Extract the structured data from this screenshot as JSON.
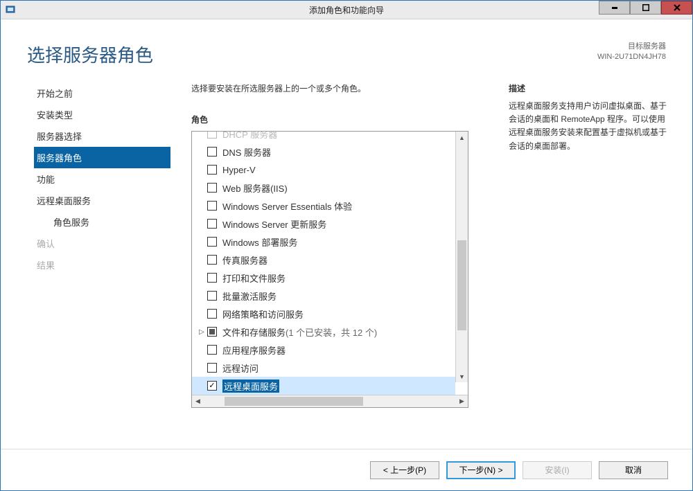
{
  "window": {
    "title": "添加角色和功能向导"
  },
  "page_title": "选择服务器角色",
  "target": {
    "label": "目标服务器",
    "name": "WIN-2U71DN4JH78"
  },
  "sidebar": {
    "items": [
      {
        "label": "开始之前",
        "active": false,
        "sub": false,
        "disabled": false
      },
      {
        "label": "安装类型",
        "active": false,
        "sub": false,
        "disabled": false
      },
      {
        "label": "服务器选择",
        "active": false,
        "sub": false,
        "disabled": false
      },
      {
        "label": "服务器角色",
        "active": true,
        "sub": false,
        "disabled": false
      },
      {
        "label": "功能",
        "active": false,
        "sub": false,
        "disabled": false
      },
      {
        "label": "远程桌面服务",
        "active": false,
        "sub": false,
        "disabled": false
      },
      {
        "label": "角色服务",
        "active": false,
        "sub": true,
        "disabled": false
      },
      {
        "label": "确认",
        "active": false,
        "sub": false,
        "disabled": true
      },
      {
        "label": "结果",
        "active": false,
        "sub": false,
        "disabled": true
      }
    ]
  },
  "main": {
    "instruction": "选择要安装在所选服务器上的一个或多个角色。",
    "roles_label": "角色",
    "roles": [
      {
        "label": "DHCP 服务器",
        "checked": false,
        "indeterminate": false,
        "expandable": false,
        "selected": false,
        "cut": true
      },
      {
        "label": "DNS 服务器",
        "checked": false,
        "indeterminate": false,
        "expandable": false,
        "selected": false
      },
      {
        "label": "Hyper-V",
        "checked": false,
        "indeterminate": false,
        "expandable": false,
        "selected": false
      },
      {
        "label": "Web 服务器(IIS)",
        "checked": false,
        "indeterminate": false,
        "expandable": false,
        "selected": false
      },
      {
        "label": "Windows Server Essentials 体验",
        "checked": false,
        "indeterminate": false,
        "expandable": false,
        "selected": false
      },
      {
        "label": "Windows Server 更新服务",
        "checked": false,
        "indeterminate": false,
        "expandable": false,
        "selected": false
      },
      {
        "label": "Windows 部署服务",
        "checked": false,
        "indeterminate": false,
        "expandable": false,
        "selected": false
      },
      {
        "label": "传真服务器",
        "checked": false,
        "indeterminate": false,
        "expandable": false,
        "selected": false
      },
      {
        "label": "打印和文件服务",
        "checked": false,
        "indeterminate": false,
        "expandable": false,
        "selected": false
      },
      {
        "label": "批量激活服务",
        "checked": false,
        "indeterminate": false,
        "expandable": false,
        "selected": false
      },
      {
        "label": "网络策略和访问服务",
        "checked": false,
        "indeterminate": false,
        "expandable": false,
        "selected": false
      },
      {
        "label": "文件和存储服务",
        "sublabel": "(1 个已安装，共 12 个)",
        "checked": false,
        "indeterminate": true,
        "expandable": true,
        "selected": false
      },
      {
        "label": "应用程序服务器",
        "checked": false,
        "indeterminate": false,
        "expandable": false,
        "selected": false
      },
      {
        "label": "远程访问",
        "checked": false,
        "indeterminate": false,
        "expandable": false,
        "selected": false
      },
      {
        "label": "远程桌面服务",
        "checked": true,
        "indeterminate": false,
        "expandable": false,
        "selected": true
      }
    ],
    "desc_label": "描述",
    "desc_text": "远程桌面服务支持用户访问虚拟桌面、基于会话的桌面和 RemoteApp 程序。可以使用远程桌面服务安装来配置基于虚拟机或基于会话的桌面部署。"
  },
  "buttons": {
    "prev": "< 上一步(P)",
    "next": "下一步(N) >",
    "install": "安装(I)",
    "cancel": "取消"
  }
}
